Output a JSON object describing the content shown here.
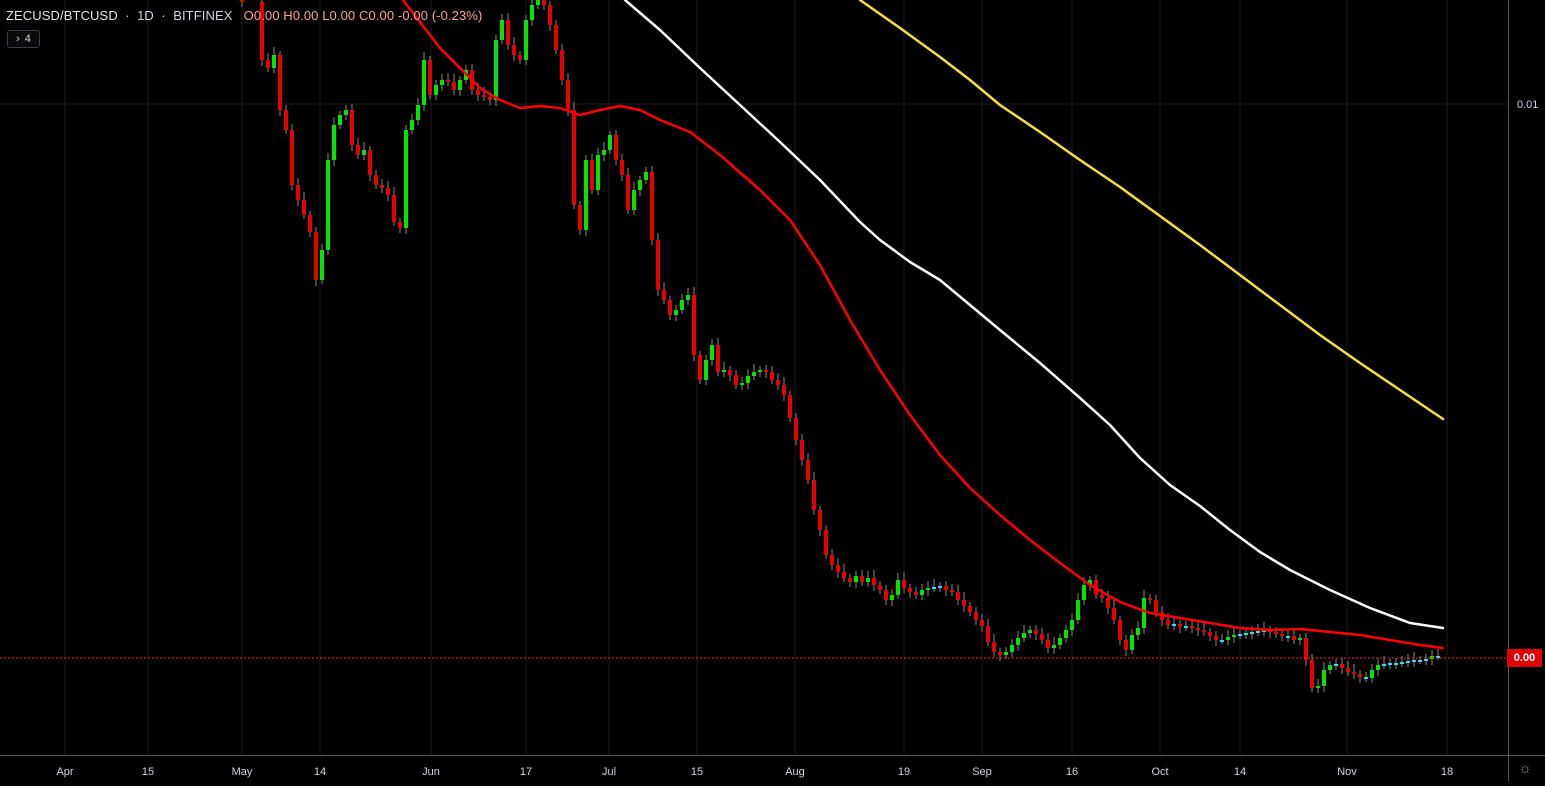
{
  "header": {
    "symbol": "ZECUSD/BTCUSD",
    "interval": "1D",
    "exchange": "BITFINEX",
    "open": "O0.00",
    "high": "H0.00",
    "low": "L0.00",
    "close": "C0.00",
    "change": "-0.00 (-0.23%)",
    "indicator_toggle_label": "4",
    "indicator_toggle_icon": "chevron-right-icon"
  },
  "price_axis": {
    "labels": [
      "0.01"
    ],
    "current_price_label": "0.00"
  },
  "chart_data": {
    "type": "candlestick",
    "x_ticks": [
      "Apr",
      "15",
      "May",
      "14",
      "Jun",
      "17",
      "Jul",
      "15",
      "Aug",
      "19",
      "Sep",
      "16",
      "Oct",
      "14",
      "Nov",
      "18"
    ],
    "y_ticks": [
      "0.01"
    ],
    "series": [
      {
        "name": "",
        "kind": "candles",
        "color_up": "#00e600",
        "color_down": "#e60000",
        "color_doji": "#33ddee"
      },
      {
        "name": "",
        "kind": "moving-average",
        "color": "#ff0000"
      },
      {
        "name": "",
        "kind": "moving-average",
        "color": "#ffffff"
      },
      {
        "name": "",
        "kind": "moving-average",
        "color": "#f5e03c"
      }
    ],
    "grid": true,
    "colors": {
      "background": "#000000",
      "grid": "#1c1c1c",
      "axis_text": "#d1d4dc",
      "price_line": "#ff2a2a"
    }
  },
  "footer": {
    "settings_icon": "gear-icon"
  }
}
